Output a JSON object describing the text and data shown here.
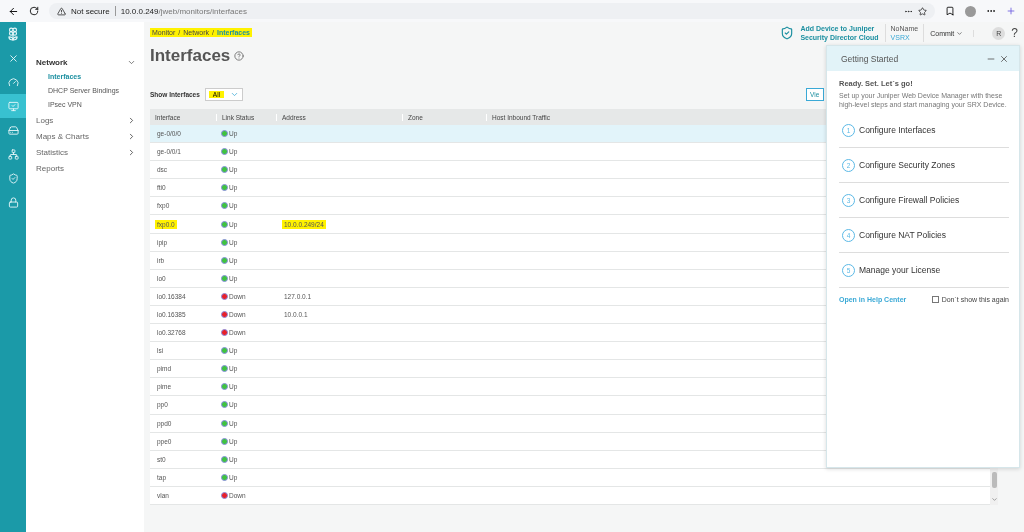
{
  "browser": {
    "security": "Not secure",
    "url_host": "10.0.0.249",
    "url_path": "/jweb/monitors/interfaces"
  },
  "rail": [
    {
      "selected": false
    },
    {
      "selected": false
    },
    {
      "selected": false
    },
    {
      "selected": true
    },
    {
      "selected": false
    },
    {
      "selected": false
    },
    {
      "selected": false
    },
    {
      "selected": false
    }
  ],
  "sidebar": [
    {
      "kind": "group",
      "label": "Network",
      "expanded": true,
      "children": [
        {
          "label": "Interfaces",
          "selected": true
        },
        {
          "label": "DHCP Server Bindings",
          "selected": false
        },
        {
          "label": "IPsec VPN",
          "selected": false
        }
      ]
    },
    {
      "kind": "group",
      "label": "Logs",
      "expanded": false
    },
    {
      "kind": "group",
      "label": "Maps & Charts",
      "expanded": false
    },
    {
      "kind": "group",
      "label": "Statistics",
      "expanded": false
    },
    {
      "kind": "link",
      "label": "Reports"
    }
  ],
  "breadcrumb": {
    "highlighted": true,
    "separator": "/",
    "items": [
      {
        "label": "Monitor",
        "current": false
      },
      {
        "label": "Network",
        "current": false
      },
      {
        "label": "Interfaces",
        "current": true
      }
    ]
  },
  "header": {
    "cloud_link": [
      "Add Device to Juniper",
      "Security Director Cloud"
    ],
    "device_name": "NoName",
    "device_model": "VSRX",
    "commit": "Commit",
    "avatar": "R",
    "help": "?"
  },
  "page_title": "Interfaces",
  "filter": {
    "label": "Show Interfaces",
    "value": "All",
    "highlighted": true
  },
  "view_button": "Vie",
  "table": {
    "columns": [
      "Interface",
      "Link Status",
      "Address",
      "Zone",
      "Host Inbound Traffic"
    ],
    "rows": [
      {
        "interface": "ge-0/0/0",
        "status": "Up",
        "up": true,
        "address": "",
        "selected": true,
        "highlighted": false
      },
      {
        "interface": "ge-0/0/1",
        "status": "Up",
        "up": true,
        "address": "",
        "selected": false,
        "highlighted": false
      },
      {
        "interface": "dsc",
        "status": "Up",
        "up": true,
        "address": "",
        "selected": false,
        "highlighted": false
      },
      {
        "interface": "fti0",
        "status": "Up",
        "up": true,
        "address": "",
        "selected": false,
        "highlighted": false
      },
      {
        "interface": "fxp0",
        "status": "Up",
        "up": true,
        "address": "",
        "selected": false,
        "highlighted": false
      },
      {
        "interface": "fxp0.0",
        "status": "Up",
        "up": true,
        "address": "10.0.0.249/24",
        "selected": false,
        "highlighted": true
      },
      {
        "interface": "ipip",
        "status": "Up",
        "up": true,
        "address": "",
        "selected": false,
        "highlighted": false
      },
      {
        "interface": "irb",
        "status": "Up",
        "up": true,
        "address": "",
        "selected": false,
        "highlighted": false
      },
      {
        "interface": "lo0",
        "status": "Up",
        "up": true,
        "address": "",
        "selected": false,
        "highlighted": false
      },
      {
        "interface": "lo0.16384",
        "status": "Down",
        "up": false,
        "address": "127.0.0.1",
        "selected": false,
        "highlighted": false
      },
      {
        "interface": "lo0.16385",
        "status": "Down",
        "up": false,
        "address": "10.0.0.1",
        "selected": false,
        "highlighted": false
      },
      {
        "interface": "lo0.32768",
        "status": "Down",
        "up": false,
        "address": "",
        "selected": false,
        "highlighted": false
      },
      {
        "interface": "lsi",
        "status": "Up",
        "up": true,
        "address": "",
        "selected": false,
        "highlighted": false
      },
      {
        "interface": "pimd",
        "status": "Up",
        "up": true,
        "address": "",
        "selected": false,
        "highlighted": false
      },
      {
        "interface": "pime",
        "status": "Up",
        "up": true,
        "address": "",
        "selected": false,
        "highlighted": false
      },
      {
        "interface": "pp0",
        "status": "Up",
        "up": true,
        "address": "",
        "selected": false,
        "highlighted": false
      },
      {
        "interface": "ppd0",
        "status": "Up",
        "up": true,
        "address": "",
        "selected": false,
        "highlighted": false
      },
      {
        "interface": "ppe0",
        "status": "Up",
        "up": true,
        "address": "",
        "selected": false,
        "highlighted": false
      },
      {
        "interface": "st0",
        "status": "Up",
        "up": true,
        "address": "",
        "selected": false,
        "highlighted": false
      },
      {
        "interface": "tap",
        "status": "Up",
        "up": true,
        "address": "",
        "selected": false,
        "highlighted": false
      },
      {
        "interface": "vlan",
        "status": "Down",
        "up": false,
        "address": "",
        "selected": false,
        "highlighted": false
      }
    ]
  },
  "panel": {
    "title": "Getting Started",
    "heading": "Ready. Set. Let´s go!",
    "description": "Set up your Juniper Web Device Manager with these high-level steps and start managing your SRX Device.",
    "steps": [
      {
        "number": "1",
        "label": "Configure Interfaces"
      },
      {
        "number": "2",
        "label": "Configure Security Zones"
      },
      {
        "number": "3",
        "label": "Configure Firewall Policies"
      },
      {
        "number": "4",
        "label": "Configure NAT Policies"
      },
      {
        "number": "5",
        "label": "Manage your License"
      }
    ],
    "help_link": "Open in Help Center",
    "dont_show": {
      "label": "Don´t show this again",
      "checked": false
    }
  }
}
